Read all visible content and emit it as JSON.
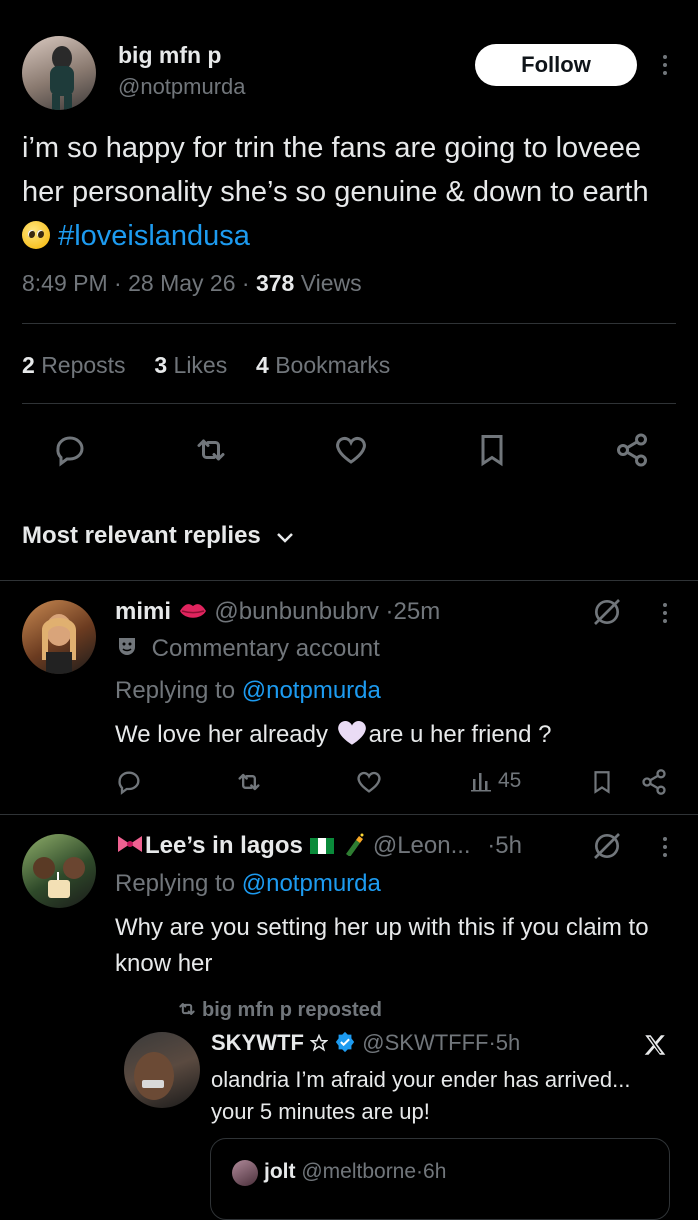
{
  "tweet": {
    "display_name": "big mfn p",
    "handle": "@notpmurda",
    "follow_label": "Follow",
    "text_main": "i’m so happy for trin the fans are going to loveee her personality she’s so genuine & down to earth",
    "hashtag": "#loveislandusa",
    "time": "8:49 PM",
    "date": "28 May 26",
    "views_count": "378",
    "views_label": "Views",
    "reposts_count": "2",
    "reposts_label": "Reposts",
    "likes_count": "3",
    "likes_label": "Likes",
    "bookmarks_count": "4",
    "bookmarks_label": "Bookmarks"
  },
  "replies_header": "Most relevant replies",
  "replies": [
    {
      "display_name": "mimi",
      "handle": "@bunbunbubrv",
      "time": "25m",
      "badge": "Commentary account",
      "replying_label": "Replying to",
      "replying_handle": "@notpmurda",
      "text_a": "We love her already",
      "text_b": "are u her friend ?",
      "views": "45"
    },
    {
      "display_name": "Lee’s in lagos",
      "handle": "@Leon...",
      "time": "5h",
      "replying_label": "Replying to",
      "replying_handle": "@notpmurda",
      "text": "Why are you setting her up with this if you claim to know her",
      "quote": {
        "repost_label": "big mfn p reposted",
        "display_name": "SKYWTF",
        "handle": "@SKWTFFF",
        "time": "5h",
        "text": "olandria I’m afraid your ender has arrived... your 5 minutes are up!",
        "nested_name": "jolt",
        "nested_handle": "@meltborne",
        "nested_time": "6h"
      }
    }
  ],
  "colors": {
    "accent": "#1d9bf0",
    "background": "#000000",
    "muted": "#71767b",
    "text": "#e7e9ea"
  }
}
